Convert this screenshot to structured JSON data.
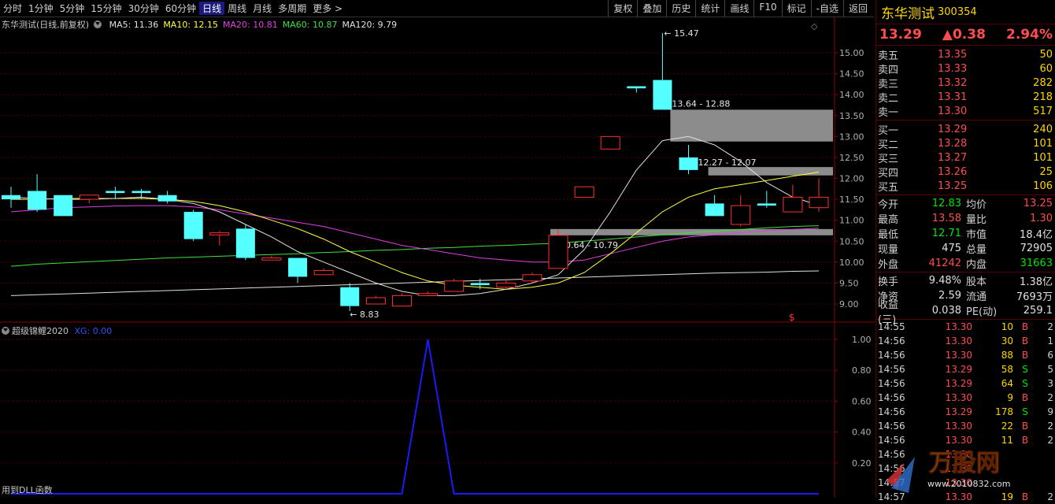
{
  "toolbar": {
    "periods": [
      "分时",
      "1分钟",
      "5分钟",
      "15分钟",
      "30分钟",
      "60分钟",
      "日线",
      "周线",
      "月线",
      "多周期",
      "更多 >"
    ],
    "active_index": 6,
    "tools": [
      "复权",
      "叠加",
      "历史",
      "统计",
      "画线",
      "F10",
      "标记",
      "-自选",
      "返回"
    ]
  },
  "info": {
    "title": "东华测试(日线,前复权)",
    "ma": [
      {
        "label": "MA5: 11.36",
        "color": "#e0e0e0"
      },
      {
        "label": "MA10: 12.15",
        "color": "#ffff40"
      },
      {
        "label": "MA20: 10.81",
        "color": "#e040e0"
      },
      {
        "label": "MA60: 10.87",
        "color": "#40e040"
      },
      {
        "label": "MA120: 9.79",
        "color": "#e0e0e0"
      }
    ]
  },
  "indicator": {
    "name": "超级锦鲤2020",
    "value": "XG: 0.00",
    "footer": "用到DLL函数"
  },
  "chart_data": {
    "type": "candlestick",
    "y_axis": [
      "15.00",
      "14.50",
      "14.00",
      "13.50",
      "13.00",
      "12.50",
      "12.00",
      "11.50",
      "11.00",
      "10.50",
      "10.00",
      "9.50",
      "9.00"
    ],
    "ind_axis": [
      "1.00",
      "0.80",
      "0.60",
      "0.40",
      "0.20"
    ],
    "annotations": {
      "high": "15.47",
      "low": "8.83",
      "zone1": "13.64 - 12.88",
      "zone2": "12.27 - 12.07",
      "zone3": "10.64 - 10.79",
      "dollar": "$"
    },
    "candles": [
      {
        "o": 11.6,
        "c": 11.5,
        "h": 11.8,
        "l": 11.3
      },
      {
        "o": 11.7,
        "c": 11.25,
        "h": 12.1,
        "l": 11.2
      },
      {
        "o": 11.6,
        "c": 11.1,
        "h": 11.6,
        "l": 11.1
      },
      {
        "o": 11.5,
        "c": 11.6,
        "h": 11.6,
        "l": 11.4
      },
      {
        "o": 11.7,
        "c": 11.65,
        "h": 11.8,
        "l": 11.5
      },
      {
        "o": 11.7,
        "c": 11.65,
        "h": 11.75,
        "l": 11.5
      },
      {
        "o": 11.6,
        "c": 11.45,
        "h": 11.7,
        "l": 11.4
      },
      {
        "o": 11.2,
        "c": 10.55,
        "h": 11.25,
        "l": 10.5
      },
      {
        "o": 10.65,
        "c": 10.7,
        "h": 10.75,
        "l": 10.4
      },
      {
        "o": 10.8,
        "c": 10.1,
        "h": 10.9,
        "l": 10.05
      },
      {
        "o": 10.05,
        "c": 10.1,
        "h": 10.15,
        "l": 10.05
      },
      {
        "o": 10.1,
        "c": 9.65,
        "h": 10.1,
        "l": 9.5
      },
      {
        "o": 9.7,
        "c": 9.8,
        "h": 9.85,
        "l": 9.7
      },
      {
        "o": 9.4,
        "c": 8.95,
        "h": 9.5,
        "l": 8.83
      },
      {
        "o": 9.0,
        "c": 9.15,
        "h": 9.2,
        "l": 9.0
      },
      {
        "o": 8.95,
        "c": 9.2,
        "h": 9.25,
        "l": 8.95
      },
      {
        "o": 9.2,
        "c": 9.25,
        "h": 9.3,
        "l": 9.2
      },
      {
        "o": 9.3,
        "c": 9.55,
        "h": 9.6,
        "l": 9.3
      },
      {
        "o": 9.5,
        "c": 9.45,
        "h": 9.6,
        "l": 9.35
      },
      {
        "o": 9.4,
        "c": 9.5,
        "h": 9.6,
        "l": 9.35
      },
      {
        "o": 9.55,
        "c": 9.7,
        "h": 9.75,
        "l": 9.5
      },
      {
        "o": 9.85,
        "c": 10.64,
        "h": 10.79,
        "l": 9.85
      },
      {
        "o": 11.55,
        "c": 11.8,
        "h": 11.8,
        "l": 11.55
      },
      {
        "o": 12.7,
        "c": 13.0,
        "h": 13.0,
        "l": 12.7
      },
      {
        "o": 14.2,
        "c": 14.15,
        "h": 14.2,
        "l": 14.05
      },
      {
        "o": 14.35,
        "c": 13.64,
        "h": 15.47,
        "l": 13.64
      },
      {
        "o": 12.5,
        "c": 12.2,
        "h": 12.8,
        "l": 12.1
      },
      {
        "o": 11.4,
        "c": 11.1,
        "h": 11.6,
        "l": 11.1
      },
      {
        "o": 10.9,
        "c": 11.35,
        "h": 11.6,
        "l": 10.85
      },
      {
        "o": 11.4,
        "c": 11.35,
        "h": 11.7,
        "l": 11.3
      },
      {
        "o": 11.2,
        "c": 11.55,
        "h": 11.85,
        "l": 11.2
      },
      {
        "o": 11.3,
        "c": 11.55,
        "h": 12.0,
        "l": 11.2
      }
    ],
    "ma5": [
      11.55,
      11.52,
      11.5,
      11.5,
      11.52,
      11.55,
      11.5,
      11.4,
      11.2,
      10.9,
      10.6,
      10.25,
      10.0,
      9.75,
      9.5,
      9.3,
      9.2,
      9.2,
      9.25,
      9.35,
      9.5,
      9.7,
      10.3,
      11.2,
      12.2,
      12.9,
      13.0,
      12.8,
      12.4,
      11.9,
      11.55,
      11.36
    ],
    "ma10": [
      11.5,
      11.5,
      11.52,
      11.52,
      11.52,
      11.52,
      11.5,
      11.45,
      11.35,
      11.2,
      11.0,
      10.8,
      10.55,
      10.25,
      10.0,
      9.75,
      9.55,
      9.45,
      9.4,
      9.35,
      9.4,
      9.5,
      9.75,
      10.2,
      10.7,
      11.2,
      11.55,
      11.75,
      11.85,
      11.95,
      12.05,
      12.15
    ],
    "ma20": [
      11.2,
      11.25,
      11.3,
      11.32,
      11.34,
      11.35,
      11.35,
      11.32,
      11.25,
      11.15,
      11.05,
      10.95,
      10.85,
      10.7,
      10.55,
      10.4,
      10.3,
      10.2,
      10.1,
      10.05,
      10.0,
      10.0,
      10.05,
      10.2,
      10.35,
      10.5,
      10.6,
      10.65,
      10.7,
      10.75,
      10.78,
      10.81
    ],
    "ma60": [
      9.9,
      9.95,
      9.98,
      10.01,
      10.04,
      10.07,
      10.1,
      10.12,
      10.14,
      10.16,
      10.18,
      10.2,
      10.23,
      10.25,
      10.28,
      10.3,
      10.33,
      10.35,
      10.38,
      10.4,
      10.43,
      10.45,
      10.5,
      10.55,
      10.6,
      10.65,
      10.7,
      10.74,
      10.78,
      10.82,
      10.85,
      10.87
    ],
    "ma120": [
      9.2,
      9.22,
      9.24,
      9.26,
      9.28,
      9.3,
      9.32,
      9.34,
      9.36,
      9.38,
      9.4,
      9.42,
      9.44,
      9.46,
      9.48,
      9.5,
      9.52,
      9.54,
      9.56,
      9.58,
      9.6,
      9.62,
      9.64,
      9.66,
      9.68,
      9.7,
      9.72,
      9.74,
      9.75,
      9.76,
      9.78,
      9.79
    ],
    "xg": [
      0,
      0,
      0,
      0,
      0,
      0,
      0,
      0,
      0,
      0,
      0,
      0,
      0,
      0,
      0,
      0,
      1,
      0,
      0,
      0,
      0,
      0,
      0,
      0,
      0,
      0,
      0,
      0,
      0,
      0,
      0,
      0
    ]
  },
  "quote": {
    "name": "东华测试",
    "code": "300354",
    "price": "13.29",
    "change": "▲0.38",
    "pct": "2.94%",
    "asks": [
      [
        "卖五",
        "13.35",
        "50"
      ],
      [
        "卖四",
        "13.33",
        "60"
      ],
      [
        "卖三",
        "13.32",
        "282"
      ],
      [
        "卖二",
        "13.31",
        "218"
      ],
      [
        "卖一",
        "13.30",
        "517"
      ]
    ],
    "bids": [
      [
        "买一",
        "13.29",
        "240"
      ],
      [
        "买二",
        "13.28",
        "101"
      ],
      [
        "买三",
        "13.27",
        "101"
      ],
      [
        "买四",
        "13.26",
        "25"
      ],
      [
        "买五",
        "13.25",
        "106"
      ]
    ],
    "stats1": [
      [
        "今开",
        "12.83",
        "green",
        "均价",
        "13.25",
        "red"
      ],
      [
        "最高",
        "13.58",
        "red",
        "量比",
        "1.30",
        "red"
      ],
      [
        "最低",
        "12.71",
        "green",
        "市值",
        "18.4亿",
        "white"
      ],
      [
        "现量",
        "475",
        "white",
        "总量",
        "72905",
        "white"
      ],
      [
        "外盘",
        "41242",
        "red",
        "内盘",
        "31663",
        "green"
      ]
    ],
    "stats2": [
      [
        "换手",
        "9.48%",
        "white",
        "股本",
        "1.38亿",
        "white"
      ],
      [
        "净资",
        "2.59",
        "white",
        "流通",
        "7693万",
        "white"
      ],
      [
        "收益(三)",
        "0.038",
        "white",
        "PE(动)",
        "259.1",
        "white"
      ]
    ],
    "ticks": [
      [
        "14:55",
        "13.30",
        "10",
        "B",
        "2"
      ],
      [
        "14:56",
        "13.30",
        "30",
        "B",
        "1"
      ],
      [
        "14:56",
        "13.30",
        "88",
        "B",
        "6"
      ],
      [
        "14:56",
        "13.29",
        "58",
        "S",
        "5"
      ],
      [
        "14:56",
        "13.29",
        "64",
        "S",
        "3"
      ],
      [
        "14:56",
        "13.30",
        "9",
        "B",
        "2"
      ],
      [
        "14:56",
        "13.29",
        "178",
        "S",
        "9"
      ],
      [
        "14:56",
        "13.30",
        "22",
        "B",
        "2"
      ],
      [
        "14:56",
        "13.30",
        "11",
        "B",
        "2"
      ],
      [
        "14:56",
        "13.30",
        "",
        "",
        ""
      ],
      [
        "14:56",
        "13.30",
        "",
        "",
        ""
      ],
      [
        "14:57",
        "13.30",
        "",
        "",
        ""
      ],
      [
        "14:57",
        "13.30",
        "19",
        "B",
        "2"
      ]
    ],
    "watermark": "万股网",
    "watermark_url": "www.2010832.com"
  }
}
